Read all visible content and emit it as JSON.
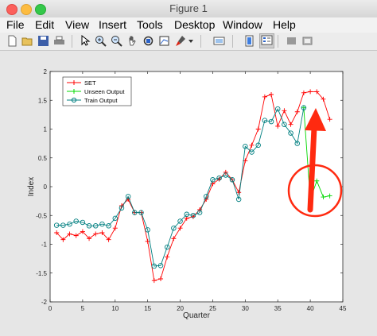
{
  "window": {
    "title": "Figure 1"
  },
  "menu": [
    "File",
    "Edit",
    "View",
    "Insert",
    "Tools",
    "Desktop",
    "Window",
    "Help"
  ],
  "toolbar_icons": [
    "new-figure-icon",
    "open-file-icon",
    "save-icon",
    "print-icon",
    "pointer-icon",
    "zoom-in-icon",
    "zoom-out-icon",
    "pan-icon",
    "rotate-3d-icon",
    "data-cursor-icon",
    "brush-icon",
    "brush-dropdown-icon",
    "link-plot-icon",
    "colorbar-icon",
    "legend-icon",
    "hide-plot-tools-icon",
    "show-plot-tools-icon"
  ],
  "chart_data": {
    "type": "line",
    "xlabel": "Quarter",
    "ylabel": "Index",
    "xlim": [
      0,
      45
    ],
    "ylim": [
      -2,
      2
    ],
    "xticks": [
      "0",
      "5",
      "10",
      "15",
      "20",
      "25",
      "30",
      "35",
      "40",
      "45"
    ],
    "yticks": [
      "-2",
      "-1.5",
      "-1",
      "-0.5",
      "0",
      "0.5",
      "1",
      "1.5",
      "2"
    ],
    "legend_position": "top-left",
    "series": [
      {
        "name": "SET",
        "color": "#ff0000",
        "marker": "+",
        "x": [
          1,
          2,
          3,
          4,
          5,
          6,
          7,
          8,
          9,
          10,
          11,
          12,
          13,
          14,
          15,
          16,
          17,
          18,
          19,
          20,
          21,
          22,
          23,
          24,
          25,
          26,
          27,
          28,
          29,
          30,
          31,
          32,
          33,
          34,
          35,
          36,
          37,
          38,
          39,
          40,
          41,
          42,
          43
        ],
        "y": [
          -0.8,
          -0.92,
          -0.82,
          -0.85,
          -0.78,
          -0.9,
          -0.82,
          -0.8,
          -0.92,
          -0.72,
          -0.33,
          -0.22,
          -0.45,
          -0.45,
          -0.95,
          -1.63,
          -1.6,
          -1.22,
          -0.9,
          -0.72,
          -0.55,
          -0.52,
          -0.4,
          -0.22,
          0.05,
          0.13,
          0.25,
          0.12,
          -0.1,
          0.45,
          0.72,
          1.0,
          1.56,
          1.6,
          1.05,
          1.32,
          1.08,
          1.3,
          1.63,
          1.65,
          1.65,
          1.52,
          1.17
        ]
      },
      {
        "name": "Unseen Output",
        "color": "#00d800",
        "marker": "+",
        "x": [
          39,
          40,
          41,
          42,
          43
        ],
        "y": [
          1.37,
          -0.22,
          0.1,
          -0.18,
          -0.16
        ]
      },
      {
        "name": "Train Output",
        "color": "#007f80",
        "marker": "o",
        "x": [
          1,
          2,
          3,
          4,
          5,
          6,
          7,
          8,
          9,
          10,
          11,
          12,
          13,
          14,
          15,
          16,
          17,
          18,
          19,
          20,
          21,
          22,
          23,
          24,
          25,
          26,
          27,
          28,
          29,
          30,
          31,
          32,
          33,
          34,
          35,
          36,
          37,
          38,
          39
        ],
        "y": [
          -0.67,
          -0.67,
          -0.65,
          -0.6,
          -0.62,
          -0.68,
          -0.68,
          -0.65,
          -0.68,
          -0.55,
          -0.37,
          -0.17,
          -0.45,
          -0.45,
          -0.75,
          -1.38,
          -1.37,
          -1.05,
          -0.72,
          -0.6,
          -0.48,
          -0.5,
          -0.45,
          -0.17,
          0.12,
          0.15,
          0.2,
          0.12,
          -0.22,
          0.7,
          0.6,
          0.72,
          1.15,
          1.13,
          1.35,
          1.08,
          0.93,
          0.75,
          1.37
        ]
      }
    ],
    "annotations": [
      {
        "type": "arrow",
        "color": "#ff0000",
        "description": "thick red arrow pointing up"
      },
      {
        "type": "circle",
        "color": "#ff0000",
        "description": "red circle around unseen output"
      }
    ]
  }
}
